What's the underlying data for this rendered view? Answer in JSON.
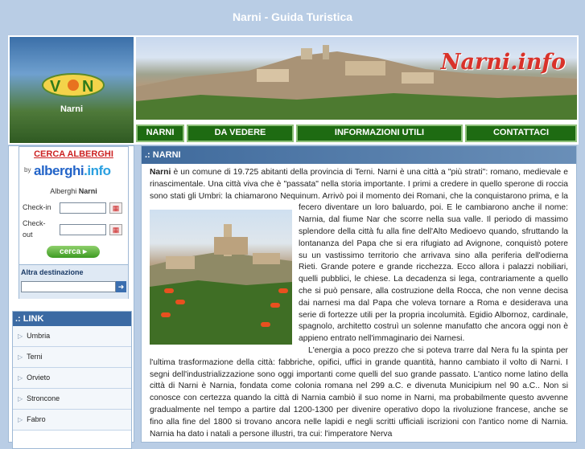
{
  "page": {
    "title": "Narni - Guida Turistica"
  },
  "header": {
    "logo_label": "Narni",
    "banner_brand": "Narni.info",
    "nav": [
      "NARNI",
      "DA VEDERE",
      "INFORMAZIONI UTILI",
      "CONTATTACI"
    ]
  },
  "hotel": {
    "heading": "CERCA ALBERGHI",
    "by": "by",
    "logo_main": "alberghi",
    "logo_suffix": ".info",
    "sub_prefix": "Alberghi ",
    "sub_city": "Narni",
    "checkin_label": "Check-in",
    "checkout_label": "Check-out",
    "search_label": "cerca",
    "alt_label": "Altra destinazione"
  },
  "links": {
    "heading": ".: LINK",
    "items": [
      "Umbria",
      "Terni",
      "Orvieto",
      "Stroncone",
      "Fabro"
    ]
  },
  "content": {
    "heading": ".: NARNI",
    "p1_bold": "Narni",
    "p1": " è un comune di 19.725 abitanti della provincia di Terni. Narni è una città a \"più strati\": romano, medievale e rinascimentale. Una città viva che è \"passata\" nella storia importante. I primi a credere in quello sperone di roccia sono stati gli Umbri: la chiamarono Nequinum. Arrivò poi il momento dei Romani, che la conquistarono prima, e la fecero diventare un loro baluardo, poi. E le cambiarono anche il nome: Narnia, dal fiume Nar che scorre nella sua valle. Il periodo di massimo splendore della città fu alla fine dell'Alto Medioevo quando, sfruttando la lontananza del Papa che si era rifugiato ad Avignone, conquistò potere su un vastissimo territorio che arrivava sino alla periferia dell'odierna Rieti. Grande potere e grande ricchezza. Ecco allora i palazzi nobiliari, quelli pubblici, le chiese. La decadenza si lega, contrariamente a quello che si può pensare, alla costruzione della Rocca, che non venne decisa dai narnesi ma dal Papa che voleva tornare a Roma e desiderava una serie di fortezze utili per la propria incolumità. Egidio Albornoz, cardinale, spagnolo, architetto costruì un solenne manufatto che ancora oggi non è appieno entrato nell'immaginario dei Narnesi.",
    "p2": "L'energia a poco prezzo che si poteva trarre dal Nera fu la spinta per l'ultima trasformazione della città: fabbriche, opifici, uffici in grande quantità, hanno cambiato il volto di Narni. I segni dell'industrializzazione sono oggi importanti come quelli del suo grande passato. L'antico nome latino della città di Narni è Narnia, fondata come colonia romana nel 299 a.C. e divenuta Municipium nel 90 a.C.. Non si conosce con certezza quando la città di Narnia cambiò il suo nome in Narni, ma probabilmente questo avvenne gradualmente nel tempo a partire dal 1200-1300 per divenire operativo dopo la rivoluzione francese, anche se fino alla fine del 1800 si trovano ancora nelle lapidi e negli scritti ufficiali iscrizioni con l'antico nome di Narnia. Narnia ha dato i natali a persone illustri, tra cui: l'imperatore Nerva"
  }
}
